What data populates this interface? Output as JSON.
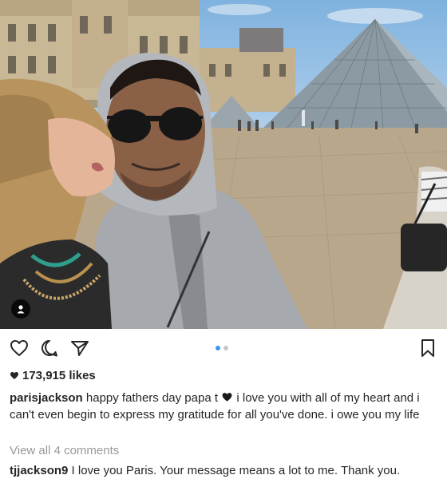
{
  "post": {
    "likes_count": "173,915 likes",
    "caption": {
      "username": "parisjackson",
      "text_part1": "happy fathers day papa t",
      "text_part2": "i love you with all of my heart and i can't even begin to express my gratitude for all you've done. i owe you my life"
    },
    "view_all_comments": "View all 4 comments",
    "comment": {
      "username": "tjjackson9",
      "text": "I love you Paris. Your message means a lot to me. Thank you."
    },
    "carousel": {
      "total": 2,
      "active_index": 0
    }
  },
  "icons": {
    "like": "heart-outline-icon",
    "comment": "speech-bubble-icon",
    "share": "paper-plane-icon",
    "save": "bookmark-icon",
    "tag": "user-tag-icon",
    "likes_heart": "heart-filled-icon",
    "caption_heart": "black-heart-emoji-icon"
  },
  "colors": {
    "text": "#262626",
    "muted": "#999999",
    "carousel_active": "#3897f0",
    "carousel_inactive": "#c7c7c7"
  }
}
